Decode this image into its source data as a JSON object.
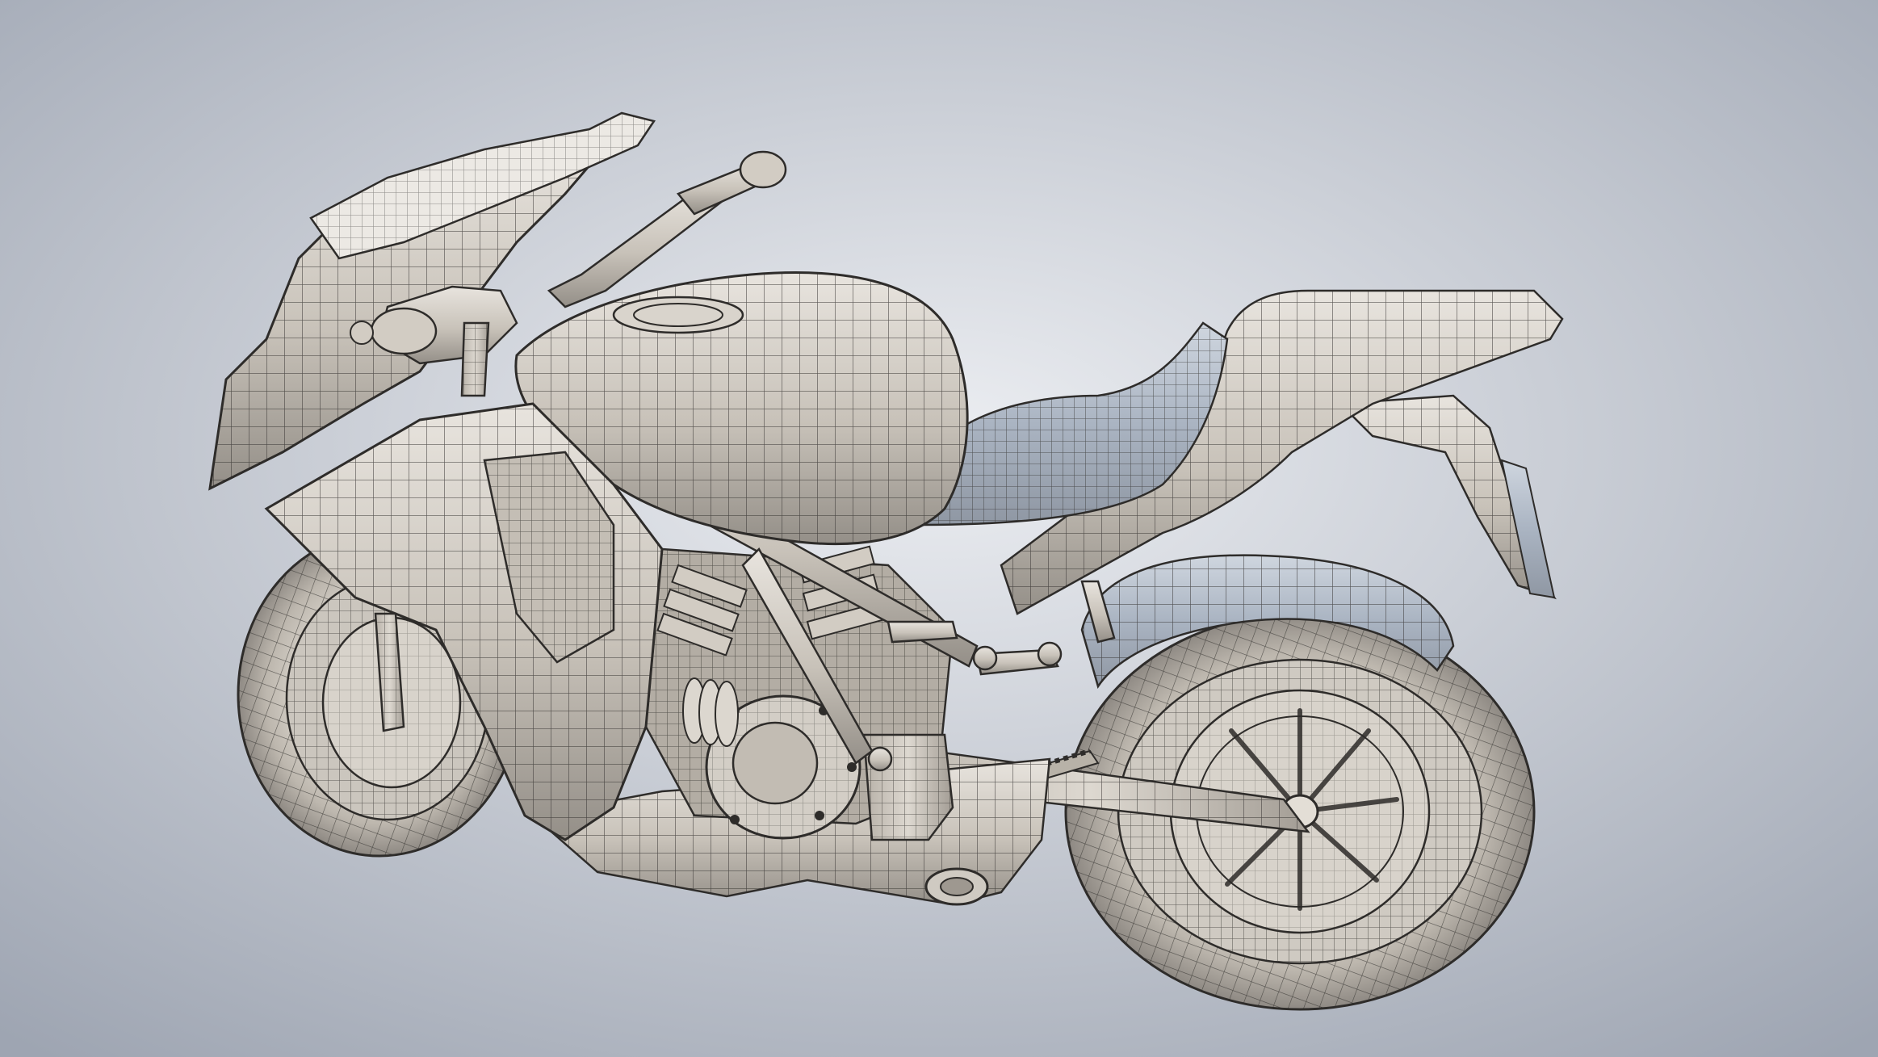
{
  "scene": {
    "subject": "motorcycle-wireframe-model",
    "background_center": "#eceef2",
    "background_edge": "#9ea5b2",
    "surface_light": "#e6e2dc",
    "surface_mid": "#c9c3ba",
    "surface_shadow": "#8c8a88",
    "surface_cool": "#aab4c2",
    "wire_color": "#2e2c2a"
  }
}
